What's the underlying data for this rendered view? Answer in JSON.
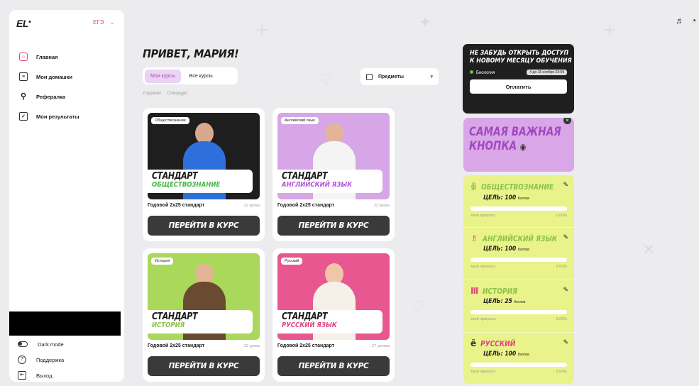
{
  "sidebar": {
    "logo": "EL",
    "exam_selector": "ЕГЭ",
    "nav": [
      {
        "label": "Главная",
        "icon": "home-icon",
        "active": true
      },
      {
        "label": "Мои домашки",
        "icon": "homework-icon",
        "active": false
      },
      {
        "label": "Рефералка",
        "icon": "add-user-icon",
        "active": false
      },
      {
        "label": "Мои результаты",
        "icon": "results-icon",
        "active": false
      }
    ],
    "dark_mode_label": "Dark mode",
    "support_label": "Поддержка",
    "logout_label": "Выход"
  },
  "main": {
    "greeting": "ПРИВЕТ, МАРИЯ!",
    "tabs": [
      "Мои курсы",
      "Все курсы"
    ],
    "subtabs": [
      "Годовой",
      "Спецкурс"
    ],
    "subject_selector": "Предметы",
    "courses": [
      {
        "tag": "Обществознание",
        "title": "СТАНДАРТ",
        "subtitle": "ОБЩЕСТВОЗНАНИЕ",
        "name": "Годовой 2х25 стандарт",
        "lessons": "22 урока",
        "button": "ПЕРЕЙТИ В КУРС",
        "bg": "#1e1e1e",
        "accent": "#45b649"
      },
      {
        "tag": "Английский язык",
        "title": "СТАНДАРТ",
        "subtitle": "АНГЛИЙСКИЙ ЯЗЫК",
        "name": "Годовой 2х25 стандарт",
        "lessons": "22 урока",
        "button": "ПЕРЕЙТИ В КУРС",
        "bg": "#d6a6e6",
        "accent": "#b656d6"
      },
      {
        "tag": "История",
        "title": "СТАНДАРТ",
        "subtitle": "ИСТОРИЯ",
        "name": "Годовой 2х25 стандарт",
        "lessons": "22 урока",
        "button": "ПЕРЕЙТИ В КУРС",
        "bg": "#a9d85a",
        "accent": "#8bc34a"
      },
      {
        "tag": "Русский",
        "title": "СТАНДАРТ",
        "subtitle": "РУССКИЙ ЯЗЫК",
        "name": "Годовой 2х25 стандарт",
        "lessons": "27 уроков",
        "button": "ПЕРЕЙТИ В КУРС",
        "bg": "#e8578f",
        "accent": "#e0467f"
      }
    ]
  },
  "reminder": {
    "title_line1": "НЕ ЗАБУДЬ ОТКРЫТЬ ДОСТУП",
    "title_line2": "К НОВОМУ МЕСЯЦУ ОБУЧЕНИЯ",
    "subject": "Биология",
    "date": "4 до 15 ноября 23:59",
    "pay_button": "Оплатить"
  },
  "promo": {
    "line1": "САМАЯ ВАЖНАЯ",
    "line2": "КНОПКА"
  },
  "goals": [
    {
      "icon": "society-icon",
      "glyph": "ꆜ",
      "title": "ОБЩЕСТВОЗНАНИЕ",
      "target": "ЦЕЛЬ: 100",
      "unit": "баллов",
      "progress_label": "твой прогресс",
      "progress": "0.00%"
    },
    {
      "icon": "english-icon",
      "glyph": "♗",
      "title": "АНГЛИЙСКИЙ ЯЗЫК",
      "target": "ЦЕЛЬ: 100",
      "unit": "баллов",
      "progress_label": "твой прогресс",
      "progress": "0.00%"
    },
    {
      "icon": "history-icon",
      "glyph": "Ⅲ",
      "title": "ИСТОРИЯ",
      "target": "ЦЕЛЬ: 25",
      "unit": "баллов",
      "progress_label": "твой прогресс",
      "progress": "0.00%"
    },
    {
      "icon": "russian-icon",
      "glyph": "ё",
      "title": "РУССКИЙ",
      "target": "ЦЕЛЬ: 100",
      "unit": "баллов",
      "progress_label": "твой прогресс",
      "progress": "0.00%"
    }
  ],
  "top_icons": [
    "music-icon",
    "bell-icon"
  ]
}
